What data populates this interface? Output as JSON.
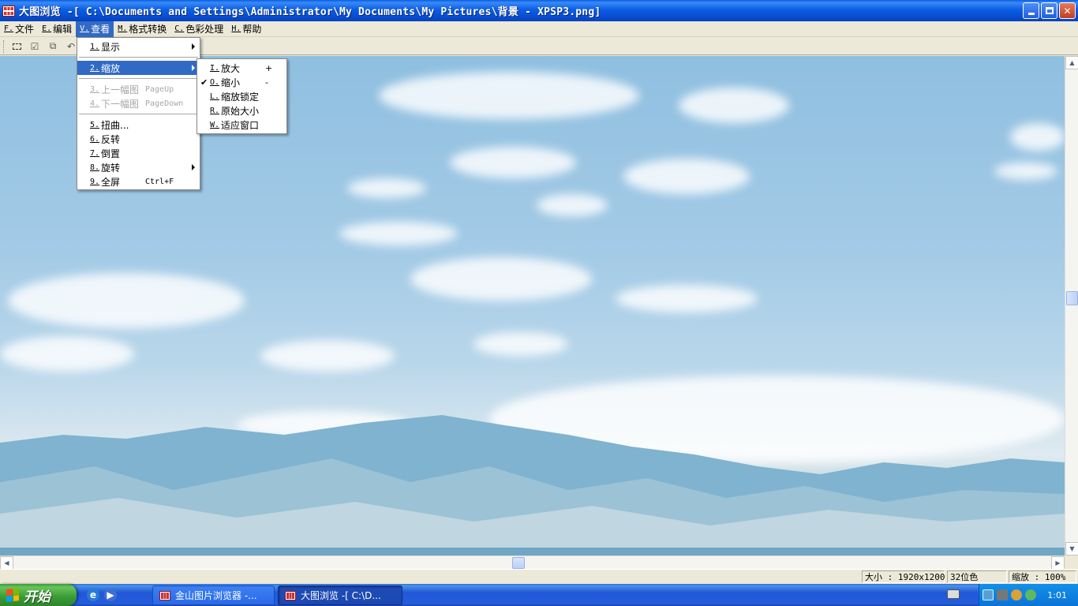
{
  "window": {
    "title": "大图浏览 -[ C:\\Documents and Settings\\Administrator\\My Documents\\My Pictures\\背景 - XPSP3.png]"
  },
  "menubar": [
    {
      "key": "F.",
      "label": "文件"
    },
    {
      "key": "E.",
      "label": "编辑"
    },
    {
      "key": "V.",
      "label": "查看"
    },
    {
      "key": "M.",
      "label": "格式转换"
    },
    {
      "key": "C.",
      "label": "色彩处理"
    },
    {
      "key": "H.",
      "label": "帮助"
    }
  ],
  "view_menu": {
    "items": [
      {
        "key": "1.",
        "label": "显示",
        "shortcut": "",
        "submenu": true
      },
      {
        "key": "2.",
        "label": "缩放",
        "shortcut": "",
        "submenu": true
      },
      {
        "key": "3.",
        "label": "上一幅图",
        "shortcut": "PageUp"
      },
      {
        "key": "4.",
        "label": "下一幅图",
        "shortcut": "PageDown"
      },
      {
        "key": "5.",
        "label": "扭曲...",
        "shortcut": ""
      },
      {
        "key": "6.",
        "label": "反转",
        "shortcut": ""
      },
      {
        "key": "7.",
        "label": "倒置",
        "shortcut": ""
      },
      {
        "key": "8.",
        "label": "旋转",
        "shortcut": "",
        "submenu": true
      },
      {
        "key": "9.",
        "label": "全屏",
        "shortcut": "Ctrl+F"
      }
    ]
  },
  "zoom_menu": {
    "items": [
      {
        "key": "I.",
        "label": "放大",
        "shortcut": "+"
      },
      {
        "key": "O.",
        "label": "缩小",
        "shortcut": "-",
        "checked": "✔"
      },
      {
        "key": "L.",
        "label": "缩放锁定",
        "shortcut": ""
      },
      {
        "key": "R.",
        "label": "原始大小",
        "shortcut": ""
      },
      {
        "key": "W.",
        "label": "适应窗口",
        "shortcut": ""
      }
    ]
  },
  "statusbar": {
    "size": "大小 : 1920x1200",
    "depth": "32位色",
    "zoom": "缩放 : 100%"
  },
  "taskbar": {
    "start_label": "开始",
    "tasks": [
      {
        "label": "金山图片浏览器 -..."
      },
      {
        "label": "大图浏览 -[ C:\\D..."
      }
    ],
    "clock": "1:01"
  },
  "colors": {
    "menu_highlight": "#316ac5",
    "titlebar_blue": "#0b5ee4",
    "taskbar_blue": "#245edb",
    "start_green": "#3a9a36"
  }
}
